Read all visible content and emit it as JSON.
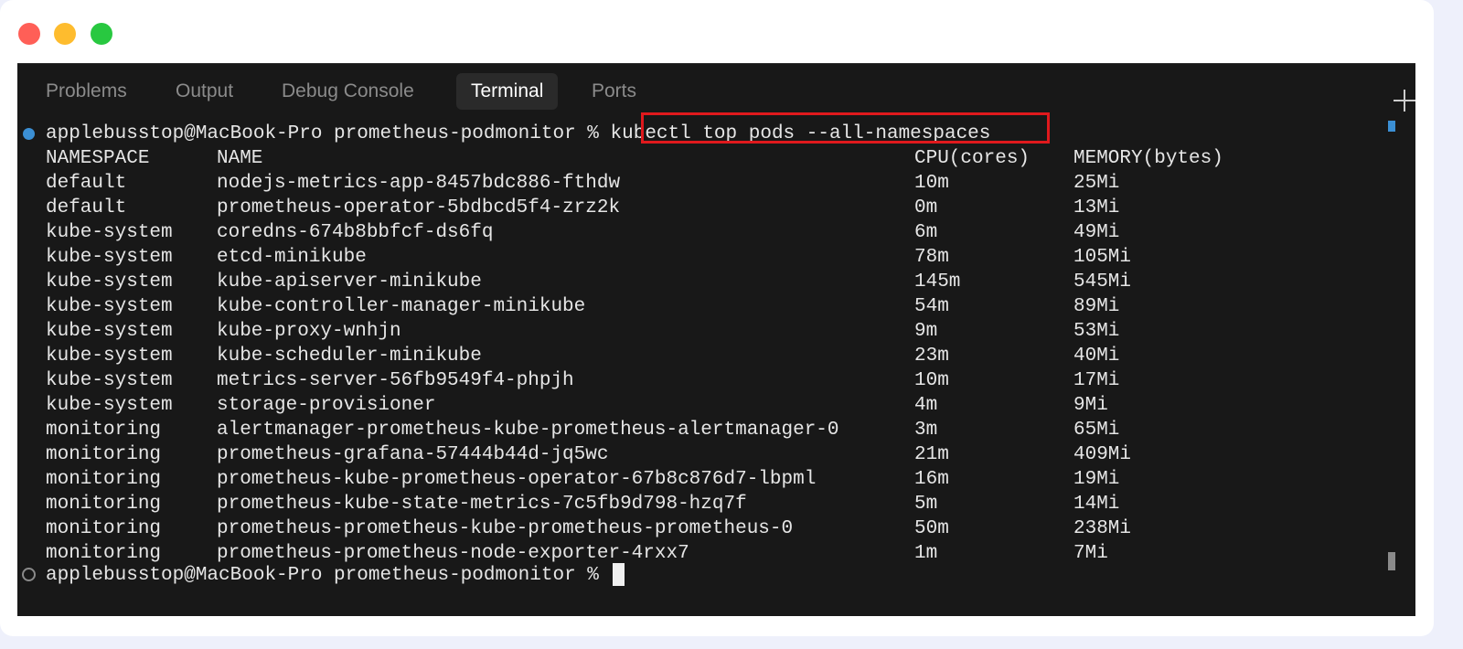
{
  "tabs": [
    {
      "label": "Problems",
      "active": false
    },
    {
      "label": "Output",
      "active": false
    },
    {
      "label": "Debug Console",
      "active": false
    },
    {
      "label": "Terminal",
      "active": true
    },
    {
      "label": "Ports",
      "active": false
    }
  ],
  "prompt1": {
    "text": "applebusstop@MacBook-Pro prometheus-podmonitor % ",
    "command": "kubectl top pods --all-namespaces"
  },
  "table": {
    "headers": [
      "NAMESPACE",
      "NAME",
      "CPU(cores)",
      "MEMORY(bytes)"
    ],
    "rows": [
      [
        "default",
        "nodejs-metrics-app-8457bdc886-fthdw",
        "10m",
        "25Mi"
      ],
      [
        "default",
        "prometheus-operator-5bdbcd5f4-zrz2k",
        "0m",
        "13Mi"
      ],
      [
        "kube-system",
        "coredns-674b8bbfcf-ds6fq",
        "6m",
        "49Mi"
      ],
      [
        "kube-system",
        "etcd-minikube",
        "78m",
        "105Mi"
      ],
      [
        "kube-system",
        "kube-apiserver-minikube",
        "145m",
        "545Mi"
      ],
      [
        "kube-system",
        "kube-controller-manager-minikube",
        "54m",
        "89Mi"
      ],
      [
        "kube-system",
        "kube-proxy-wnhjn",
        "9m",
        "53Mi"
      ],
      [
        "kube-system",
        "kube-scheduler-minikube",
        "23m",
        "40Mi"
      ],
      [
        "kube-system",
        "metrics-server-56fb9549f4-phpjh",
        "10m",
        "17Mi"
      ],
      [
        "kube-system",
        "storage-provisioner",
        "4m",
        "9Mi"
      ],
      [
        "monitoring",
        "alertmanager-prometheus-kube-prometheus-alertmanager-0",
        "3m",
        "65Mi"
      ],
      [
        "monitoring",
        "prometheus-grafana-57444b44d-jq5wc",
        "21m",
        "409Mi"
      ],
      [
        "monitoring",
        "prometheus-kube-prometheus-operator-67b8c876d7-lbpml",
        "16m",
        "19Mi"
      ],
      [
        "monitoring",
        "prometheus-kube-state-metrics-7c5fb9d798-hzq7f",
        "5m",
        "14Mi"
      ],
      [
        "monitoring",
        "prometheus-prometheus-kube-prometheus-prometheus-0",
        "50m",
        "238Mi"
      ],
      [
        "monitoring",
        "prometheus-prometheus-node-exporter-4rxx7",
        "1m",
        "7Mi"
      ]
    ]
  },
  "prompt2": {
    "text": "applebusstop@MacBook-Pro prometheus-podmonitor % "
  },
  "colors": {
    "highlight": "#e0191d",
    "terminal_bg": "#181818",
    "prompt_dot": "#3b8fd4"
  }
}
